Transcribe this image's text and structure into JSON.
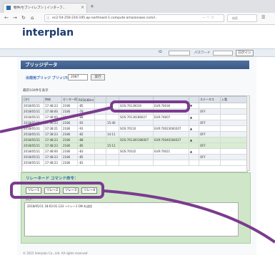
{
  "browser": {
    "tab_title": "物件/セブンイレブン | インターフ...",
    "url": "ec2-54-250-216-195.ap-northeast-1.compute.amazonaws.com/i..",
    "search_placeholder": "検索"
  },
  "site": {
    "logo": "interplan",
    "login": {
      "id_label": "ID",
      "password_label": "パスワード",
      "button": "ログイン"
    }
  },
  "page": {
    "section_title": "ブリッジデータ",
    "filter": {
      "label": "出荷用ブリッジ ブリッジID：",
      "selected": "2087",
      "button": "実行"
    },
    "count_text": "最新100件を表示"
  },
  "table": {
    "columns": [
      "日付",
      "時刻",
      "センターID",
      "RSSI(dBm)",
      "",
      "",
      "",
      "",
      "",
      "ステータス",
      "入電"
    ],
    "rows": [
      [
        "2018/05/11",
        "17:48:23",
        "2186",
        "-85",
        "",
        "",
        "SOS:70130019",
        "EUR:70030",
        "▼",
        "",
        ""
      ],
      [
        "2018/05/11",
        "17:48:00",
        "2186",
        "-79",
        "",
        "",
        "",
        "",
        "",
        "OFF",
        ""
      ],
      [
        "2018/05/11",
        "17:48:00",
        "2186",
        "-88",
        "",
        "",
        "SOS:70130186027",
        "EUR:74607",
        "▲",
        "",
        ""
      ],
      [
        "2018/05/11",
        "17:36:23",
        "2186",
        "-91",
        "",
        "15:40",
        "",
        "",
        "",
        "OFF",
        ""
      ],
      [
        "2018/05/11",
        "17:38:21",
        "2186",
        "-91",
        "",
        "",
        "SOS:70110",
        "EUR:70023000207",
        "▲",
        "",
        ""
      ],
      [
        "2018/05/11",
        "17:38:23",
        "2186",
        "-82",
        "",
        "14:11",
        "",
        "",
        "",
        "OFF",
        ""
      ],
      [
        "2018/05/11",
        "17:48:23",
        "2186",
        "-88",
        "",
        "",
        "SOS:701300186007",
        "EUR:70040184027",
        "▲",
        "",
        ""
      ],
      [
        "2018/05/11",
        "17:48:23",
        "2186",
        "-85",
        "",
        "15:11",
        "",
        "",
        "",
        "OFF",
        ""
      ],
      [
        "2018/05/11",
        "17:48:00",
        "2186",
        "-83",
        "",
        "",
        "SOS:70102",
        "EUR:70021",
        "▲",
        "",
        ""
      ],
      [
        "2018/05/11",
        "17:48:23",
        "2186",
        "-85",
        "",
        "",
        "",
        "",
        "",
        "OFF",
        ""
      ],
      [
        "2018/05/11",
        "17:48:23",
        "2186",
        "-81",
        "",
        "",
        "",
        "",
        "",
        "",
        ""
      ]
    ]
  },
  "relay": {
    "title": "リレーネード コマンド命令：",
    "buttons": [
      "リレー1",
      "リレー2",
      "リレー3",
      "リレー4"
    ],
    "log_label": "ログ：",
    "log_line": "2018/05/11 18:03:01.133 →リレー1 ON を送信"
  },
  "footer": "© 2015 Interplan Co., Ltd. All rights reserved",
  "annotation_color": "#7b3b8e"
}
